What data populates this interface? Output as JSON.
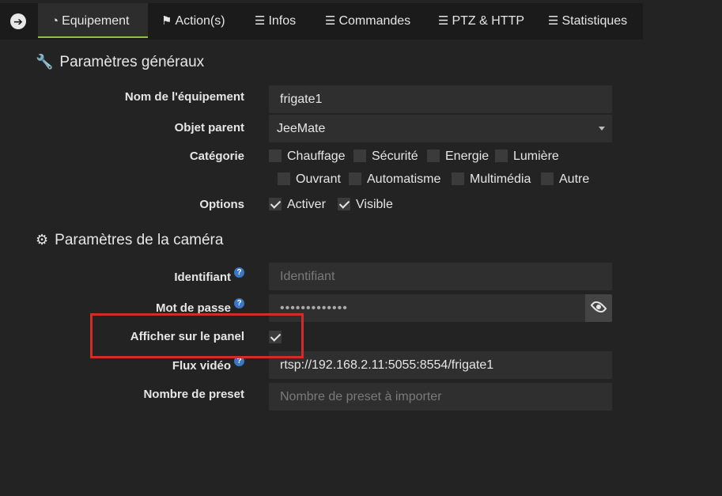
{
  "tabs": [
    {
      "label": "Equipement",
      "icon": "dashboard-icon"
    },
    {
      "label": "Action(s)",
      "icon": "flag-icon"
    },
    {
      "label": "Infos",
      "icon": "list-icon"
    },
    {
      "label": "Commandes",
      "icon": "list-icon"
    },
    {
      "label": "PTZ & HTTP",
      "icon": "list-icon"
    },
    {
      "label": "Statistiques",
      "icon": "list-icon"
    }
  ],
  "general": {
    "title": "Paramètres généraux",
    "name_label": "Nom de l'équipement",
    "name_value": "frigate1",
    "parent_label": "Objet parent",
    "parent_value": "JeeMate",
    "category_label": "Catégorie",
    "categories": [
      {
        "label": "Chauffage",
        "checked": false
      },
      {
        "label": "Sécurité",
        "checked": false
      },
      {
        "label": "Energie",
        "checked": false
      },
      {
        "label": "Lumière",
        "checked": false
      },
      {
        "label": "Ouvrant",
        "checked": false
      },
      {
        "label": "Automatisme",
        "checked": false
      },
      {
        "label": "Multimédia",
        "checked": false
      },
      {
        "label": "Autre",
        "checked": false
      }
    ],
    "options_label": "Options",
    "options": [
      {
        "label": "Activer",
        "checked": true
      },
      {
        "label": "Visible",
        "checked": true
      }
    ]
  },
  "camera": {
    "title": "Paramètres de la caméra",
    "id_label": "Identifiant",
    "id_placeholder": "Identifiant",
    "password_label": "Mot de passe",
    "password_value": "•••••••••••••",
    "panel_label": "Afficher sur le panel",
    "panel_checked": true,
    "stream_label": "Flux vidéo",
    "stream_value": "rtsp://192.168.2.11:5055:8554/frigate1",
    "preset_label": "Nombre de preset",
    "preset_placeholder": "Nombre de preset à importer",
    "help_glyph": "?"
  },
  "colors": {
    "background": "#232323",
    "active_tab_border": "#8bc34a",
    "highlight_box": "#d32a2a",
    "help_icon": "#3a78c6"
  }
}
